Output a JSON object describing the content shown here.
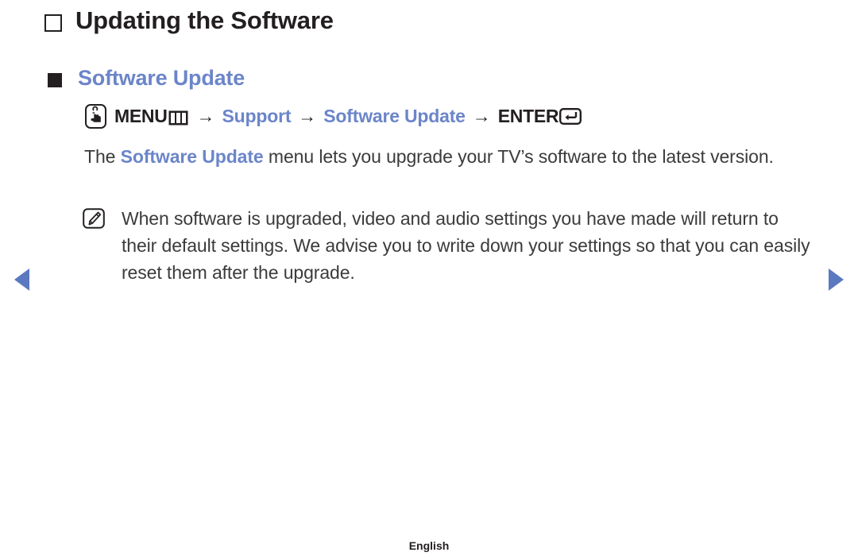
{
  "page": {
    "title": "Updating the Software",
    "title_bullet_icon": "hollow-box-bullet-icon"
  },
  "section": {
    "bullet_icon": "solid-box-bullet-icon",
    "heading": "Software Update"
  },
  "menu_path": {
    "remote_icon": "remote-press-icon",
    "menu_label": "MENU",
    "menu_grid_icon": "menu-grid-icon",
    "arrow_1": "→",
    "item_1": "Support",
    "arrow_2": "→",
    "item_2": "Software Update",
    "arrow_3": "→",
    "enter_label": "ENTER",
    "enter_icon": "enter-return-icon"
  },
  "body": {
    "lead": "The ",
    "highlight": "Software Update",
    "rest": " menu lets you upgrade your TV’s software to the latest version."
  },
  "note": {
    "icon": "note-pencil-icon",
    "text": "When software is upgraded, video and audio settings you have made will return to their default settings. We advise you to write down your settings so that you can easily reset them after the upgrade."
  },
  "nav": {
    "prev_icon": "triangle-left-icon",
    "next_icon": "triangle-right-icon"
  },
  "footer": {
    "language": "English"
  },
  "colors": {
    "accent_blue": "#6b85c9",
    "nav_blue": "#5b79c1",
    "text_dark": "#231f20",
    "body_text": "#3b3b3b",
    "background": "#ffffff"
  }
}
